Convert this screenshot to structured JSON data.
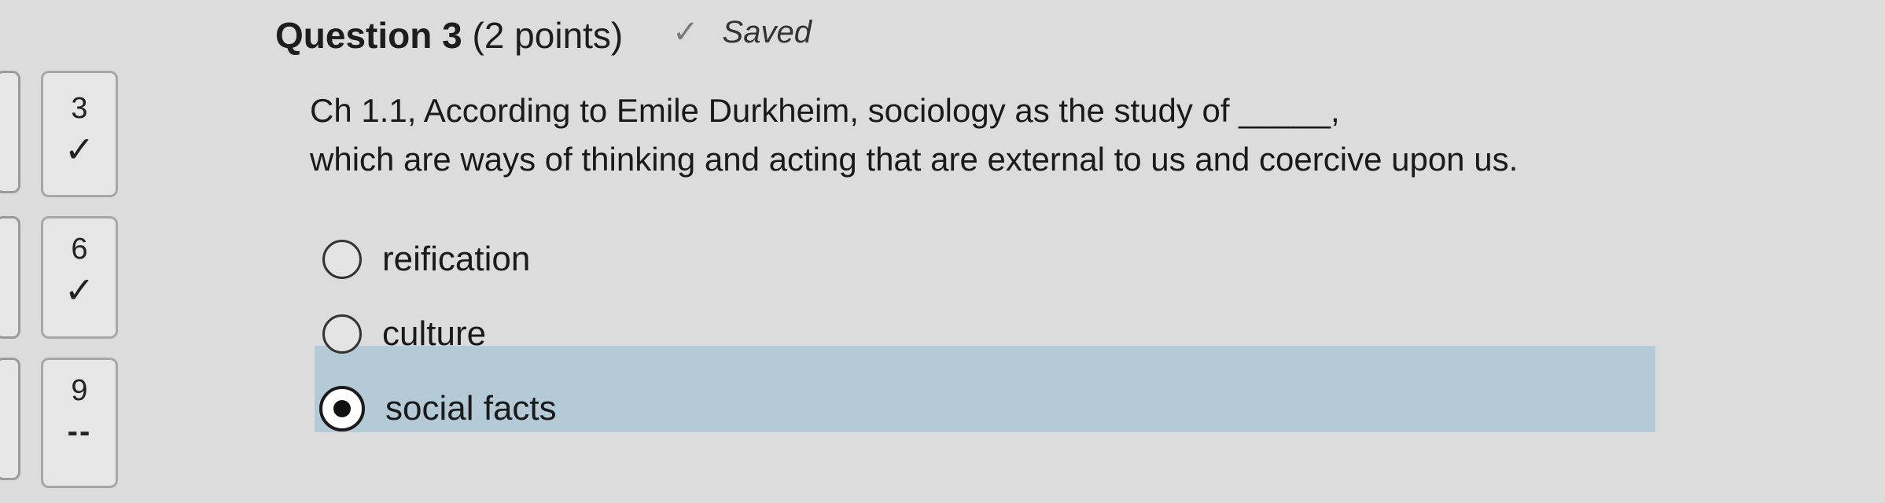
{
  "question": {
    "title": "Question 3",
    "points": "(2 points)",
    "saved_label": "Saved",
    "text_line1": "Ch 1.1, According to Emile Durkheim, sociology as the study of _____,",
    "text_line2": "which are ways of thinking and acting that are external to us and coercive upon us."
  },
  "options": [
    {
      "label": "reification",
      "selected": false
    },
    {
      "label": "culture",
      "selected": false
    },
    {
      "label": "social facts",
      "selected": true
    }
  ],
  "navigator": [
    {
      "number": "3",
      "status": "✓"
    },
    {
      "number": "6",
      "status": "✓"
    },
    {
      "number": "9",
      "status": "--"
    }
  ],
  "icons": {
    "saved": "checkmark-icon",
    "answered": "checkmark-icon"
  },
  "colors": {
    "selected_highlight": "#b4cad6",
    "background": "#dcdcdc"
  }
}
